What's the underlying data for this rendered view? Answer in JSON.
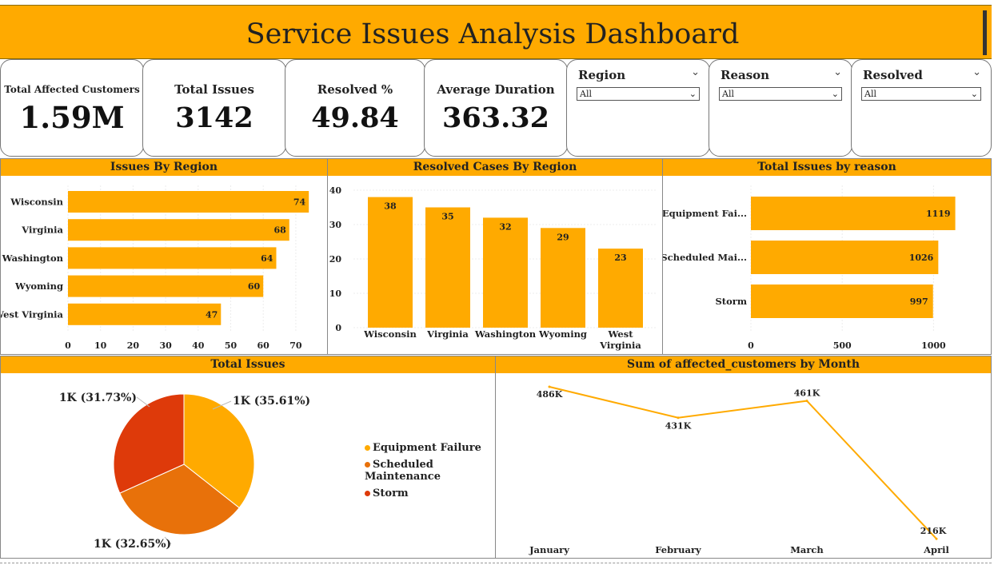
{
  "title": "Service Issues Analysis Dashboard",
  "kpis": {
    "affected": {
      "label": "Total Affected Customers",
      "value": "1.59M"
    },
    "issues": {
      "label": "Total Issues",
      "value": "3142"
    },
    "resolved": {
      "label": "Resolved %",
      "value": "49.84"
    },
    "duration": {
      "label": "Average Duration",
      "value": "363.32"
    }
  },
  "slicers": {
    "region": {
      "label": "Region",
      "value": "All"
    },
    "reason": {
      "label": "Reason",
      "value": "All"
    },
    "resolved": {
      "label": "Resolved",
      "value": "All"
    }
  },
  "colors": {
    "accent": "#FFAA00",
    "equipment": "#FFAA00",
    "scheduled": "#E8710A",
    "storm": "#DE3A0A"
  },
  "panels": {
    "issues_by_region": "Issues By Region",
    "resolved_by_region": "Resolved Cases By Region",
    "issues_by_reason": "Total Issues by reason",
    "total_issues_pie": "Total Issues",
    "affected_by_month": "Sum of affected_customers by Month"
  },
  "chart_data": [
    {
      "type": "bar",
      "orientation": "horizontal",
      "title": "Issues By Region",
      "categories": [
        "Wisconsin",
        "Virginia",
        "Washington",
        "Wyoming",
        "West Virginia"
      ],
      "values": [
        74,
        68,
        64,
        60,
        47
      ],
      "xticks": [
        "0",
        "10",
        "20",
        "30",
        "40",
        "50",
        "60",
        "70"
      ],
      "xlim": [
        0,
        77
      ]
    },
    {
      "type": "bar",
      "title": "Resolved Cases By Region",
      "categories": [
        "Wisconsin",
        "Virginia",
        "Washington",
        "Wyoming",
        "West Virginia"
      ],
      "values": [
        38,
        35,
        32,
        29,
        23
      ],
      "yticks": [
        "0",
        "10",
        "20",
        "30",
        "40"
      ],
      "ylim": [
        0,
        40
      ]
    },
    {
      "type": "bar",
      "orientation": "horizontal",
      "title": "Total Issues by reason",
      "categories": [
        "Equipment Fai...",
        "Scheduled Mai...",
        "Storm"
      ],
      "values": [
        1119,
        1026,
        997
      ],
      "xticks": [
        "0",
        "500",
        "1000"
      ],
      "xlim": [
        0,
        1150
      ]
    },
    {
      "type": "pie",
      "title": "Total Issues",
      "labels": [
        "Equipment Failure",
        "Scheduled Maintenance",
        "Storm"
      ],
      "values": [
        35.61,
        32.65,
        31.73
      ],
      "data_labels": [
        "1K (35.61%)",
        "1K (32.65%)",
        "1K (31.73%)"
      ]
    },
    {
      "type": "line",
      "title": "Sum of affected_customers by Month",
      "categories": [
        "January",
        "February",
        "March",
        "April"
      ],
      "values": [
        486,
        431,
        461,
        216
      ],
      "data_labels": [
        "486K",
        "431K",
        "461K",
        "216K"
      ]
    }
  ]
}
